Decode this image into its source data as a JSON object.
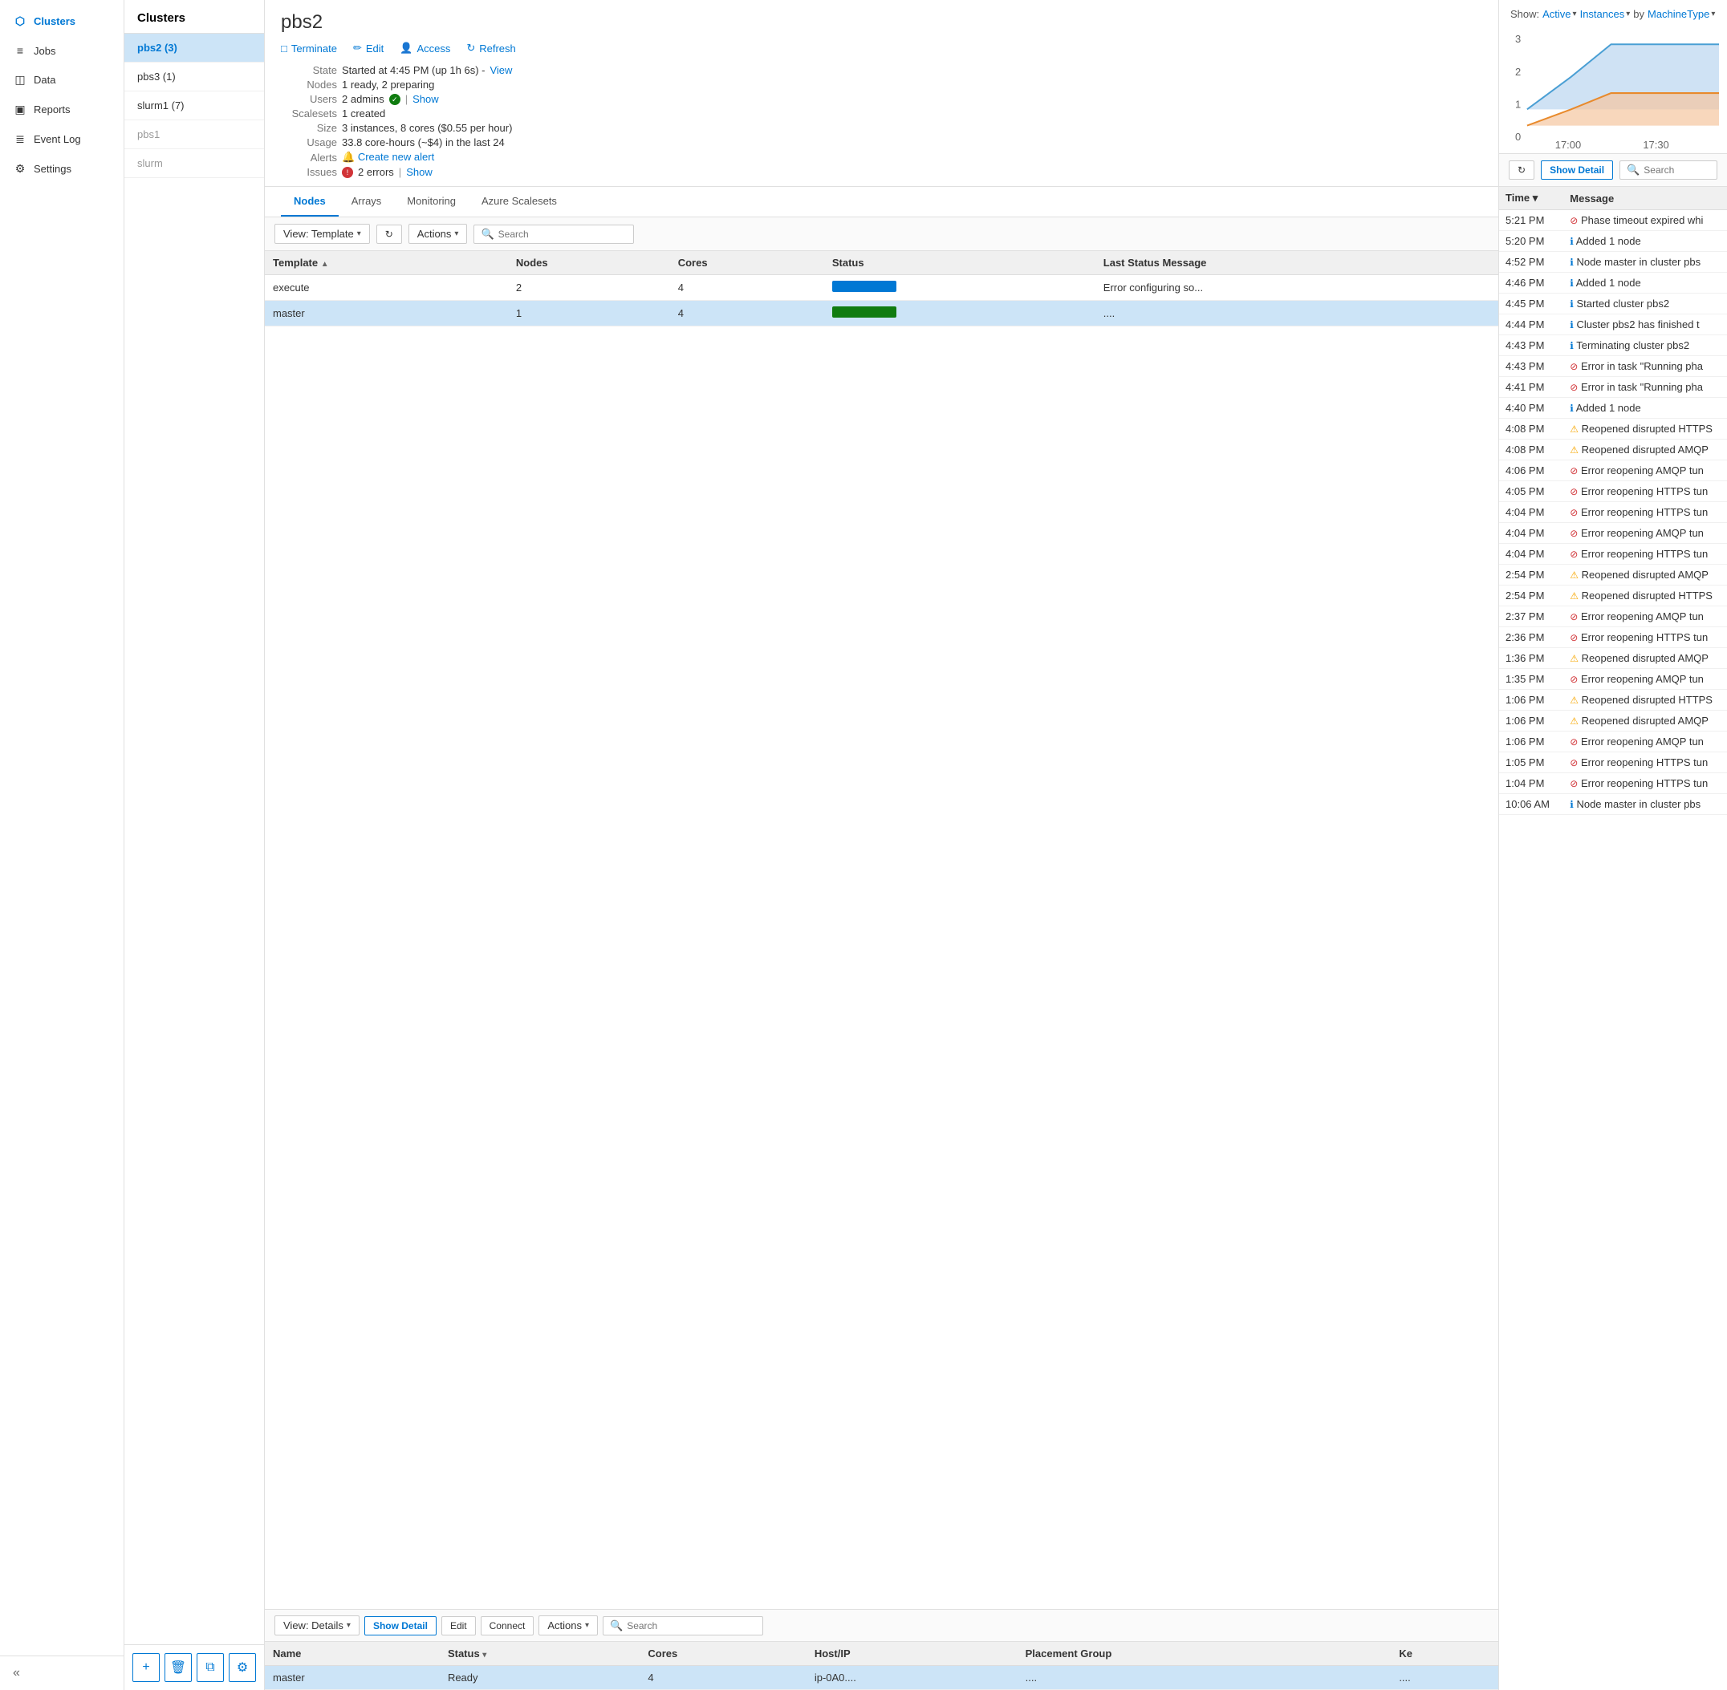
{
  "nav": {
    "items": [
      {
        "id": "clusters",
        "label": "Clusters",
        "icon": "⬡",
        "active": true
      },
      {
        "id": "jobs",
        "label": "Jobs",
        "icon": "≡"
      },
      {
        "id": "data",
        "label": "Data",
        "icon": "◫"
      },
      {
        "id": "reports",
        "label": "Reports",
        "icon": "📊"
      },
      {
        "id": "eventlog",
        "label": "Event Log",
        "icon": "≣"
      },
      {
        "id": "settings",
        "label": "Settings",
        "icon": "⚙"
      }
    ],
    "collapse_label": "«"
  },
  "cluster_list": {
    "title": "Clusters",
    "items": [
      {
        "id": "pbs2",
        "label": "pbs2 (3)",
        "active": true
      },
      {
        "id": "pbs3",
        "label": "pbs3 (1)"
      },
      {
        "id": "slurm1",
        "label": "slurm1 (7)"
      },
      {
        "id": "pbs1",
        "label": "pbs1",
        "disabled": true
      },
      {
        "id": "slurm",
        "label": "slurm",
        "disabled": true
      }
    ],
    "footer_buttons": [
      {
        "id": "add",
        "icon": "+",
        "label": "Add cluster"
      },
      {
        "id": "delete",
        "icon": "🗑",
        "label": "Delete cluster"
      },
      {
        "id": "copy",
        "icon": "⧉",
        "label": "Copy cluster"
      },
      {
        "id": "settings",
        "icon": "⚙",
        "label": "Cluster settings"
      }
    ]
  },
  "cluster_detail": {
    "title": "pbs2",
    "actions": [
      {
        "id": "terminate",
        "icon": "□",
        "label": "Terminate"
      },
      {
        "id": "edit",
        "icon": "✏",
        "label": "Edit"
      },
      {
        "id": "access",
        "icon": "👤",
        "label": "Access"
      },
      {
        "id": "refresh",
        "icon": "↻",
        "label": "Refresh"
      }
    ],
    "info": {
      "state_label": "State",
      "state_value": "Started at 4:45 PM (up 1h 6s) -",
      "state_link": "View",
      "nodes_label": "Nodes",
      "nodes_value": "1 ready, 2 preparing",
      "users_label": "Users",
      "users_value": "2 admins",
      "users_link": "Show",
      "scalesets_label": "Scalesets",
      "scalesets_value": "1 created",
      "size_label": "Size",
      "size_value": "3 instances, 8 cores ($0.55 per hour)",
      "usage_label": "Usage",
      "usage_value": "33.8 core-hours (~$4) in the last 24",
      "alerts_label": "Alerts",
      "alerts_link": "Create new alert",
      "issues_label": "Issues",
      "issues_count": "2 errors",
      "issues_link": "Show"
    },
    "tabs": [
      "Nodes",
      "Arrays",
      "Monitoring",
      "Azure Scalesets"
    ],
    "active_tab": "Nodes",
    "toolbar": {
      "view_label": "View: Template",
      "actions_label": "Actions",
      "search_placeholder": "Search"
    },
    "nodes_table": {
      "columns": [
        "Template",
        "Nodes",
        "Cores",
        "Status",
        "Last Status Message"
      ],
      "rows": [
        {
          "template": "execute",
          "nodes": "2",
          "cores": "4",
          "status": "blue",
          "message": "Error configuring so..."
        },
        {
          "template": "master",
          "nodes": "1",
          "cores": "4",
          "status": "green",
          "message": "...."
        }
      ]
    },
    "lower_toolbar": {
      "view_label": "View: Details",
      "show_detail_label": "Show Detail",
      "edit_label": "Edit",
      "connect_label": "Connect",
      "actions_label": "Actions",
      "search_placeholder": "Search"
    },
    "instances_table": {
      "columns": [
        "Name",
        "Status",
        "Cores",
        "Host/IP",
        "Placement Group",
        "Ke"
      ],
      "rows": [
        {
          "name": "master",
          "status": "Ready",
          "cores": "4",
          "host": "ip-0A0....",
          "placement": "....",
          "ke": "...."
        }
      ]
    }
  },
  "chart": {
    "show_label": "Show:",
    "active_label": "Active",
    "instances_label": "Instances",
    "by_label": "by",
    "machine_type_label": "MachineType",
    "y_labels": [
      "3",
      "2",
      "1",
      "0"
    ],
    "x_labels": [
      "17:00",
      "17:30"
    ]
  },
  "event_log": {
    "refresh_label": "↻",
    "show_detail_label": "Show Detail",
    "search_placeholder": "Search",
    "columns": [
      "Time",
      "▼",
      "Message"
    ],
    "rows": [
      {
        "time": "5:21 PM",
        "icon": "error",
        "message": "Phase timeout expired whi"
      },
      {
        "time": "5:20 PM",
        "icon": "info",
        "message": "Added 1 node"
      },
      {
        "time": "4:52 PM",
        "icon": "info",
        "message": "Node master in cluster pbs"
      },
      {
        "time": "4:46 PM",
        "icon": "info",
        "message": "Added 1 node"
      },
      {
        "time": "4:45 PM",
        "icon": "info",
        "message": "Started cluster pbs2"
      },
      {
        "time": "4:44 PM",
        "icon": "info",
        "message": "Cluster pbs2 has finished t"
      },
      {
        "time": "4:43 PM",
        "icon": "info",
        "message": "Terminating cluster pbs2"
      },
      {
        "time": "4:43 PM",
        "icon": "error",
        "message": "Error in task \"Running pha"
      },
      {
        "time": "4:41 PM",
        "icon": "error",
        "message": "Error in task \"Running pha"
      },
      {
        "time": "4:40 PM",
        "icon": "info",
        "message": "Added 1 node"
      },
      {
        "time": "4:08 PM",
        "icon": "warn",
        "message": "Reopened disrupted HTTPS"
      },
      {
        "time": "4:08 PM",
        "icon": "warn",
        "message": "Reopened disrupted AMQP"
      },
      {
        "time": "4:06 PM",
        "icon": "error",
        "message": "Error reopening AMQP tun"
      },
      {
        "time": "4:05 PM",
        "icon": "error",
        "message": "Error reopening HTTPS tun"
      },
      {
        "time": "4:04 PM",
        "icon": "error",
        "message": "Error reopening HTTPS tun"
      },
      {
        "time": "4:04 PM",
        "icon": "error",
        "message": "Error reopening AMQP tun"
      },
      {
        "time": "4:04 PM",
        "icon": "error",
        "message": "Error reopening HTTPS tun"
      },
      {
        "time": "2:54 PM",
        "icon": "warn",
        "message": "Reopened disrupted AMQP"
      },
      {
        "time": "2:54 PM",
        "icon": "warn",
        "message": "Reopened disrupted HTTPS"
      },
      {
        "time": "2:37 PM",
        "icon": "error",
        "message": "Error reopening AMQP tun"
      },
      {
        "time": "2:36 PM",
        "icon": "error",
        "message": "Error reopening HTTPS tun"
      },
      {
        "time": "1:36 PM",
        "icon": "warn",
        "message": "Reopened disrupted AMQP"
      },
      {
        "time": "1:35 PM",
        "icon": "error",
        "message": "Error reopening AMQP tun"
      },
      {
        "time": "1:06 PM",
        "icon": "warn",
        "message": "Reopened disrupted HTTPS"
      },
      {
        "time": "1:06 PM",
        "icon": "warn",
        "message": "Reopened disrupted AMQP"
      },
      {
        "time": "1:06 PM",
        "icon": "error",
        "message": "Error reopening AMQP tun"
      },
      {
        "time": "1:05 PM",
        "icon": "error",
        "message": "Error reopening HTTPS tun"
      },
      {
        "time": "1:04 PM",
        "icon": "error",
        "message": "Error reopening HTTPS tun"
      },
      {
        "time": "10:06 AM",
        "icon": "info",
        "message": "Node master in cluster pbs"
      }
    ]
  }
}
